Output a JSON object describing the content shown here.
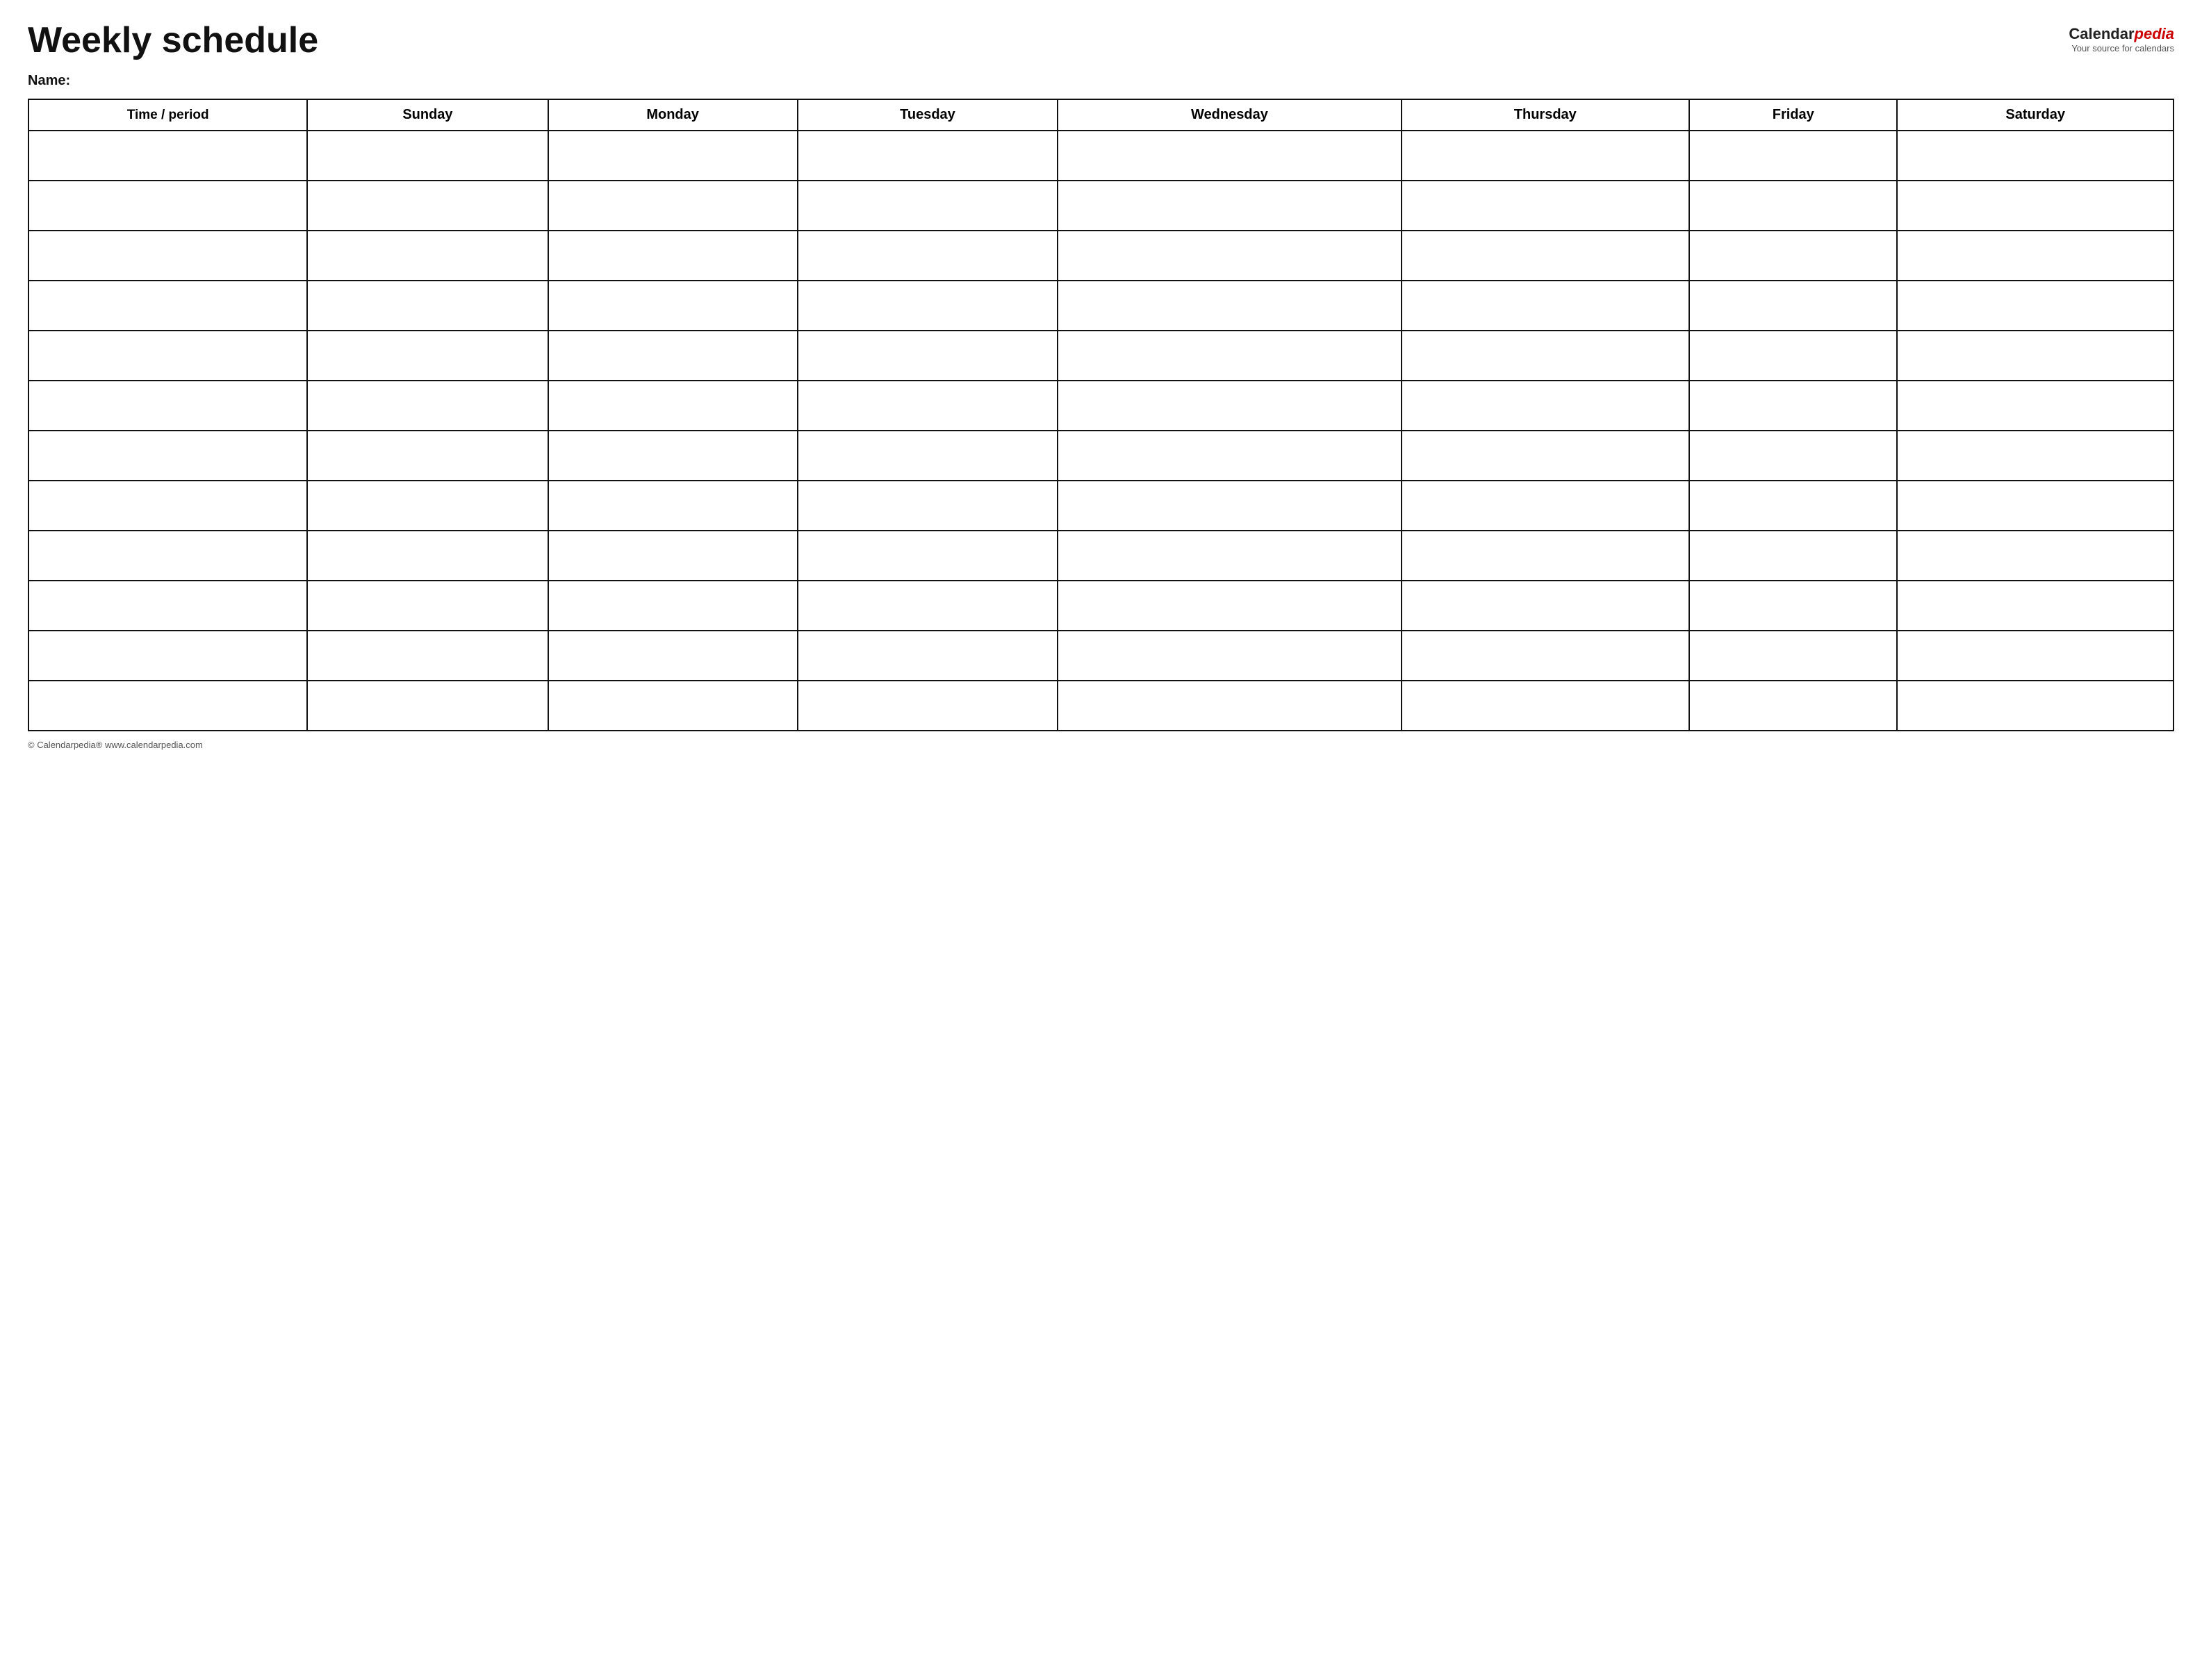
{
  "header": {
    "title": "Weekly schedule",
    "logo": {
      "calendar_part": "Calendar",
      "pedia_part": "pedia",
      "subtitle": "Your source for calendars"
    }
  },
  "name_label": "Name:",
  "table": {
    "columns": [
      "Time / period",
      "Sunday",
      "Monday",
      "Tuesday",
      "Wednesday",
      "Thursday",
      "Friday",
      "Saturday"
    ],
    "row_count": 12
  },
  "footer": {
    "text": "© Calendarpedia®  www.calendarpedia.com"
  }
}
